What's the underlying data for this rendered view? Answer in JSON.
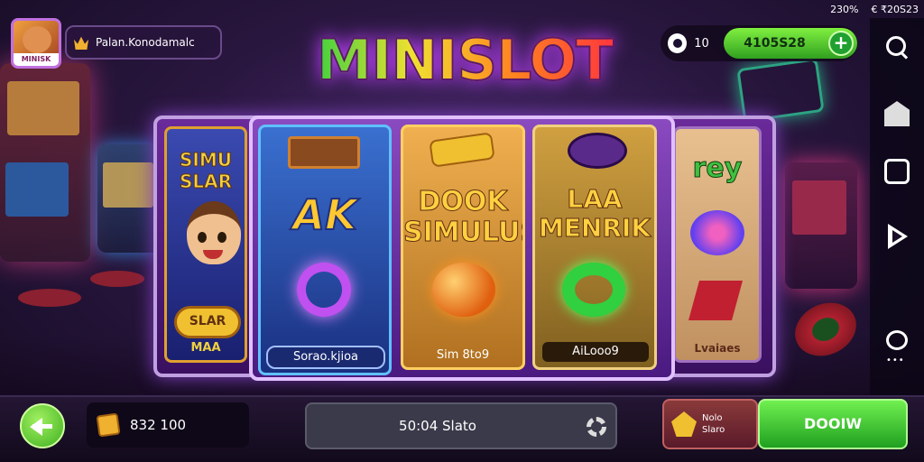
{
  "status_bar": {
    "left_value": "230%",
    "right_value": "€ ₹20S23"
  },
  "profile": {
    "avatar_tag": "MINISK",
    "name": "Palan.Konodamalc"
  },
  "title": "MINISLOT",
  "coins": {
    "count": "10",
    "balance": "4105S28"
  },
  "reels": {
    "left_side": {
      "top_text": "SIMU SLAR",
      "bottom_badge": "SLAR",
      "label": "MAA"
    },
    "reel1": {
      "symbol_text": "AK",
      "label": "Sorao.kjioa"
    },
    "reel2": {
      "symbol_text": "DOOK SIMULUS",
      "label": "Sim 8to9"
    },
    "reel3": {
      "symbol_text": "LAA MENRIK",
      "label": "AiLooo9"
    },
    "right_side": {
      "top_text": "rey",
      "label": "Lvaiaes"
    }
  },
  "bottom_bar": {
    "wallet_amount": "832 100",
    "status_text": "50:04 Slato",
    "bet_label": "Nolo Slaro",
    "spin_label": "DOOIW"
  },
  "icons": [
    "avatar",
    "crown-icon",
    "eye-icon",
    "plus-icon",
    "search-icon",
    "home-icon",
    "tab-icon",
    "play-icon",
    "chat-icon",
    "back-arrow-icon",
    "chest-icon",
    "gear-icon",
    "bet-icon"
  ],
  "colors": {
    "accent_green": "#40b020",
    "frame_purple": "#6a2a9a",
    "bg_dark": "#140b22"
  }
}
